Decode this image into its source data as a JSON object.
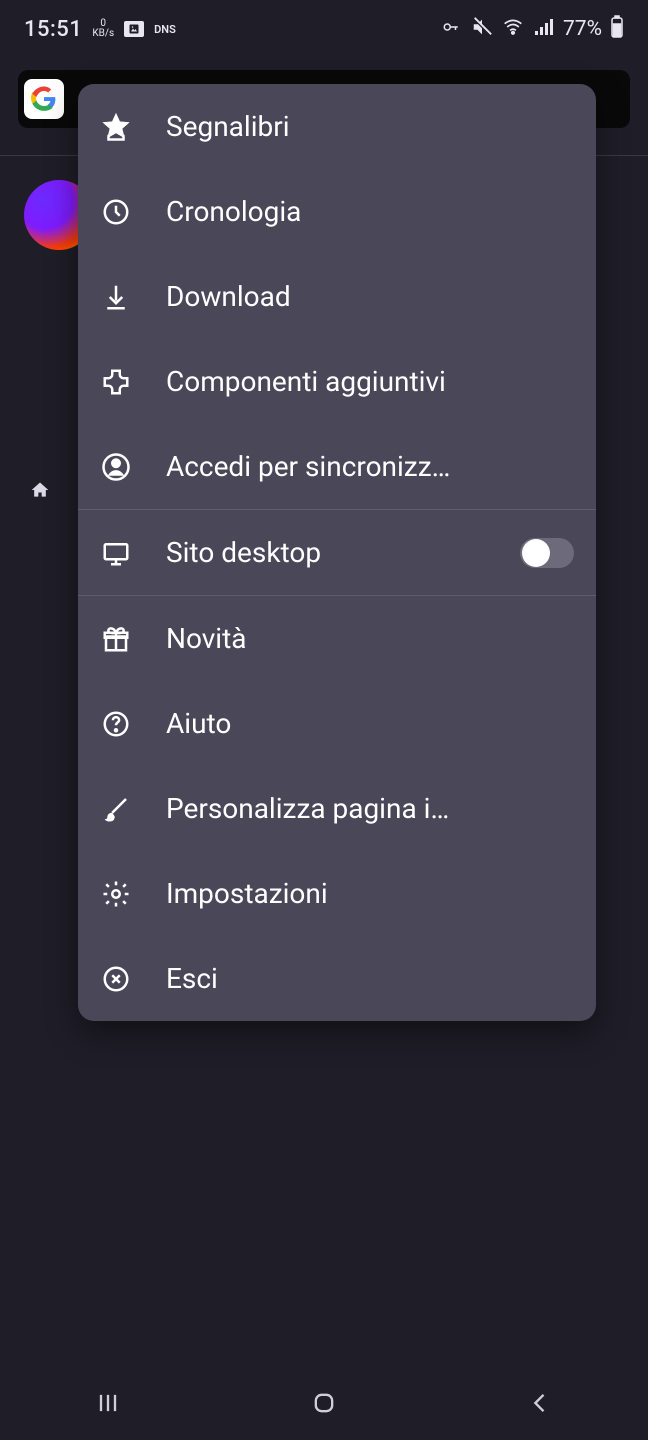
{
  "status": {
    "time": "15:51",
    "kb_top": "0",
    "kb_bot": "KB/s",
    "dns": "DNS",
    "battery": "77%"
  },
  "menu": {
    "bookmarks": "Segnalibri",
    "history": "Cronologia",
    "downloads": "Download",
    "addons": "Componenti aggiuntivi",
    "sync": "Accedi per sincronizz…",
    "desktop_site": "Sito desktop",
    "whatsnew": "Novità",
    "help": "Aiuto",
    "customize": "Personalizza pagina i…",
    "settings": "Impostazioni",
    "quit": "Esci"
  }
}
